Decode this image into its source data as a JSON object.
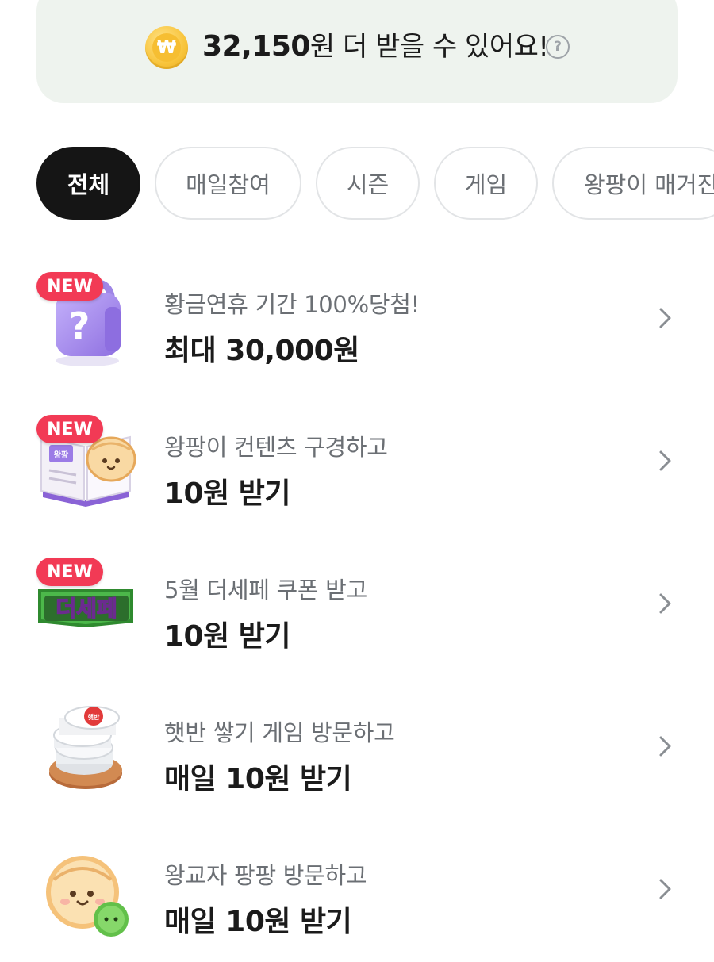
{
  "banner": {
    "coin_symbol": "₩",
    "amount": "32,150",
    "suffix": "원 더 받을 수 있어요!",
    "help_symbol": "?"
  },
  "filters": [
    {
      "label": "전체",
      "active": true
    },
    {
      "label": "매일참여",
      "active": false
    },
    {
      "label": "시즌",
      "active": false
    },
    {
      "label": "게임",
      "active": false
    },
    {
      "label": "왕팡이 매거진",
      "active": false
    }
  ],
  "missions": [
    {
      "badge": "NEW",
      "icon": "mystery-box-icon",
      "subtitle": "황금연휴 기간 100%당첨!",
      "reward": "최대 30,000원"
    },
    {
      "badge": "NEW",
      "icon": "magazine-dumpling-icon",
      "subtitle": "왕팡이 컨텐츠 구경하고",
      "reward": "10원 받기",
      "icon_text": "왕팡"
    },
    {
      "badge": "NEW",
      "icon": "desepe-logo-icon",
      "subtitle": "5월 더세페 쿠폰 받고",
      "reward": "10원 받기",
      "icon_text": "더세페"
    },
    {
      "badge": "",
      "icon": "rice-stack-icon",
      "subtitle": "햇반 쌓기 게임 방문하고",
      "reward": "매일 10원 받기",
      "icon_text": "햇반"
    },
    {
      "badge": "",
      "icon": "dumpling-character-icon",
      "subtitle": "왕교자 팡팡 방문하고",
      "reward": "매일 10원 받기"
    }
  ],
  "colors": {
    "banner_bg": "#eef3ee",
    "chip_active_bg": "#151515",
    "new_badge": "#f23a55",
    "coin": "#f6be32"
  }
}
